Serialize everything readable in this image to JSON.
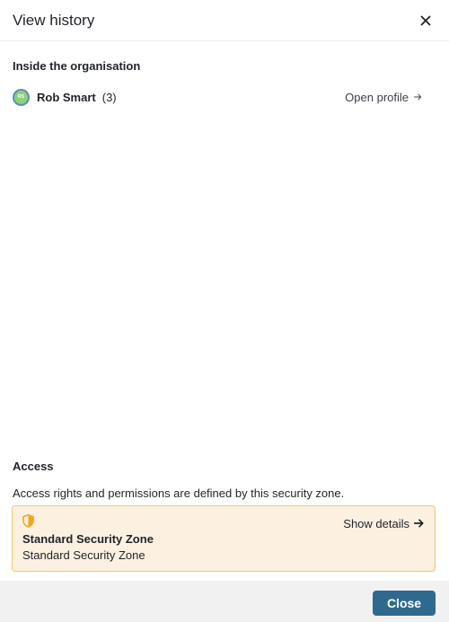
{
  "dialog": {
    "title": "View history",
    "close_icon": "close-icon"
  },
  "organisation": {
    "section_title": "Inside the organisation",
    "person": {
      "avatar_initials": "RS",
      "name": "Rob Smart",
      "count": "(3)",
      "open_profile_label": "Open profile",
      "open_profile_icon": "arrow-right-icon"
    }
  },
  "access": {
    "section_title": "Access",
    "description": "Access rights and permissions are defined by this security zone.",
    "zone": {
      "icon": "shield-icon",
      "show_details_label": "Show details",
      "show_details_icon": "arrow-right-icon",
      "name": "Standard Security Zone",
      "subtitle": "Standard Security Zone"
    }
  },
  "footer": {
    "close_label": "Close"
  },
  "colors": {
    "primary": "#2f6a8e",
    "zone_background": "#fcf0e1",
    "zone_border": "#f3c96a",
    "shield": "#f0a820",
    "avatar": "#8fd17a"
  }
}
